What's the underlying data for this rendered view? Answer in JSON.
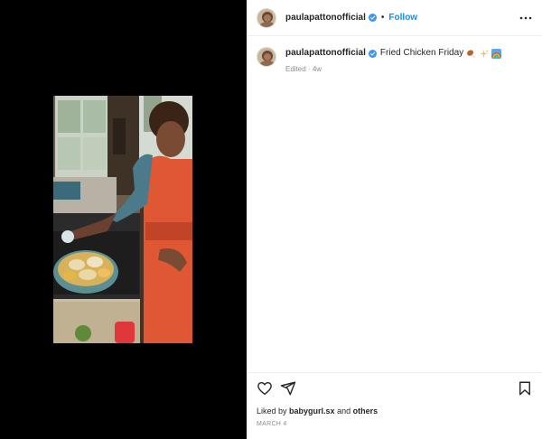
{
  "post": {
    "username": "paulapattonofficial",
    "follow_label": "Follow",
    "separator": "•",
    "caption_text": "Fried Chicken Friday",
    "caption_emojis": [
      "drumstick-emoji",
      "sparkles-emoji",
      "rainbow-emoji"
    ],
    "edited_label": "Edited",
    "meta_separator": "·",
    "age": "4w",
    "liked_by_prefix": "Liked by",
    "liked_by_user": "babygurl.sx",
    "liked_by_and": "and",
    "liked_by_others": "others",
    "date": "MARCH 4"
  },
  "colors": {
    "follow_blue": "#0095f6",
    "verified_blue": "#3897f0",
    "muted": "#8e8e8e"
  },
  "icons": {
    "more": "more-options-icon",
    "like": "heart-icon",
    "share": "send-icon",
    "save": "bookmark-icon",
    "verified": "verified-badge-icon"
  }
}
